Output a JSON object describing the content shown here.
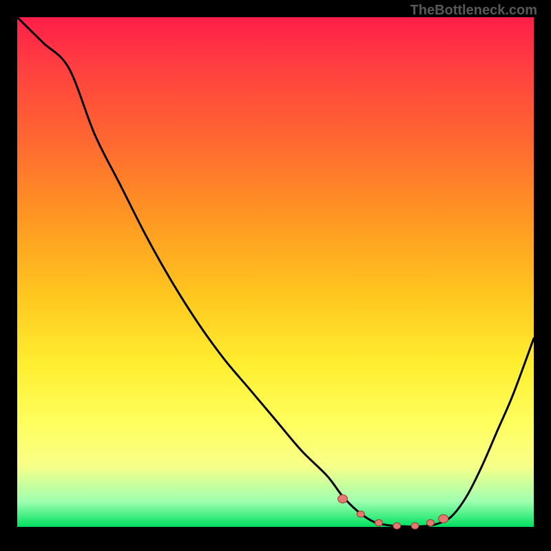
{
  "watermark": "TheBottleneck.com",
  "colors": {
    "curve": "#000000",
    "marker_fill": "#e27a72",
    "marker_stroke": "#9b352e"
  },
  "chart_data": {
    "type": "line",
    "title": "",
    "xlabel": "",
    "ylabel": "",
    "xlim": [
      0,
      100
    ],
    "ylim": [
      0,
      100
    ],
    "note": "y = bottleneck percentage (0 at bottom / optimal). V-shaped curve with minimum in the 70–80 x-range. Values estimated from pixels.",
    "x": [
      0,
      5,
      10,
      15,
      20,
      25,
      30,
      35,
      40,
      45,
      50,
      55,
      60,
      63,
      66,
      69,
      72,
      75,
      78,
      81,
      84,
      87,
      90,
      93,
      96,
      100
    ],
    "values": [
      100,
      95,
      90,
      77,
      67,
      57,
      48,
      40,
      33,
      27,
      21,
      15,
      10,
      6,
      3,
      1,
      0.3,
      0.1,
      0.1,
      0.5,
      2,
      6,
      12,
      19,
      26,
      37
    ],
    "markers_x": [
      63,
      66.5,
      70,
      73.5,
      77,
      80,
      82.5
    ],
    "markers_y": [
      5.5,
      2.5,
      0.8,
      0.2,
      0.2,
      0.8,
      1.6
    ],
    "gradient_stops": [
      {
        "pos": 0,
        "color": "#ff1e4a"
      },
      {
        "pos": 25,
        "color": "#ff6a30"
      },
      {
        "pos": 55,
        "color": "#ffc820"
      },
      {
        "pos": 80,
        "color": "#ffff60"
      },
      {
        "pos": 95,
        "color": "#9fffb0"
      },
      {
        "pos": 100,
        "color": "#00e060"
      }
    ]
  }
}
